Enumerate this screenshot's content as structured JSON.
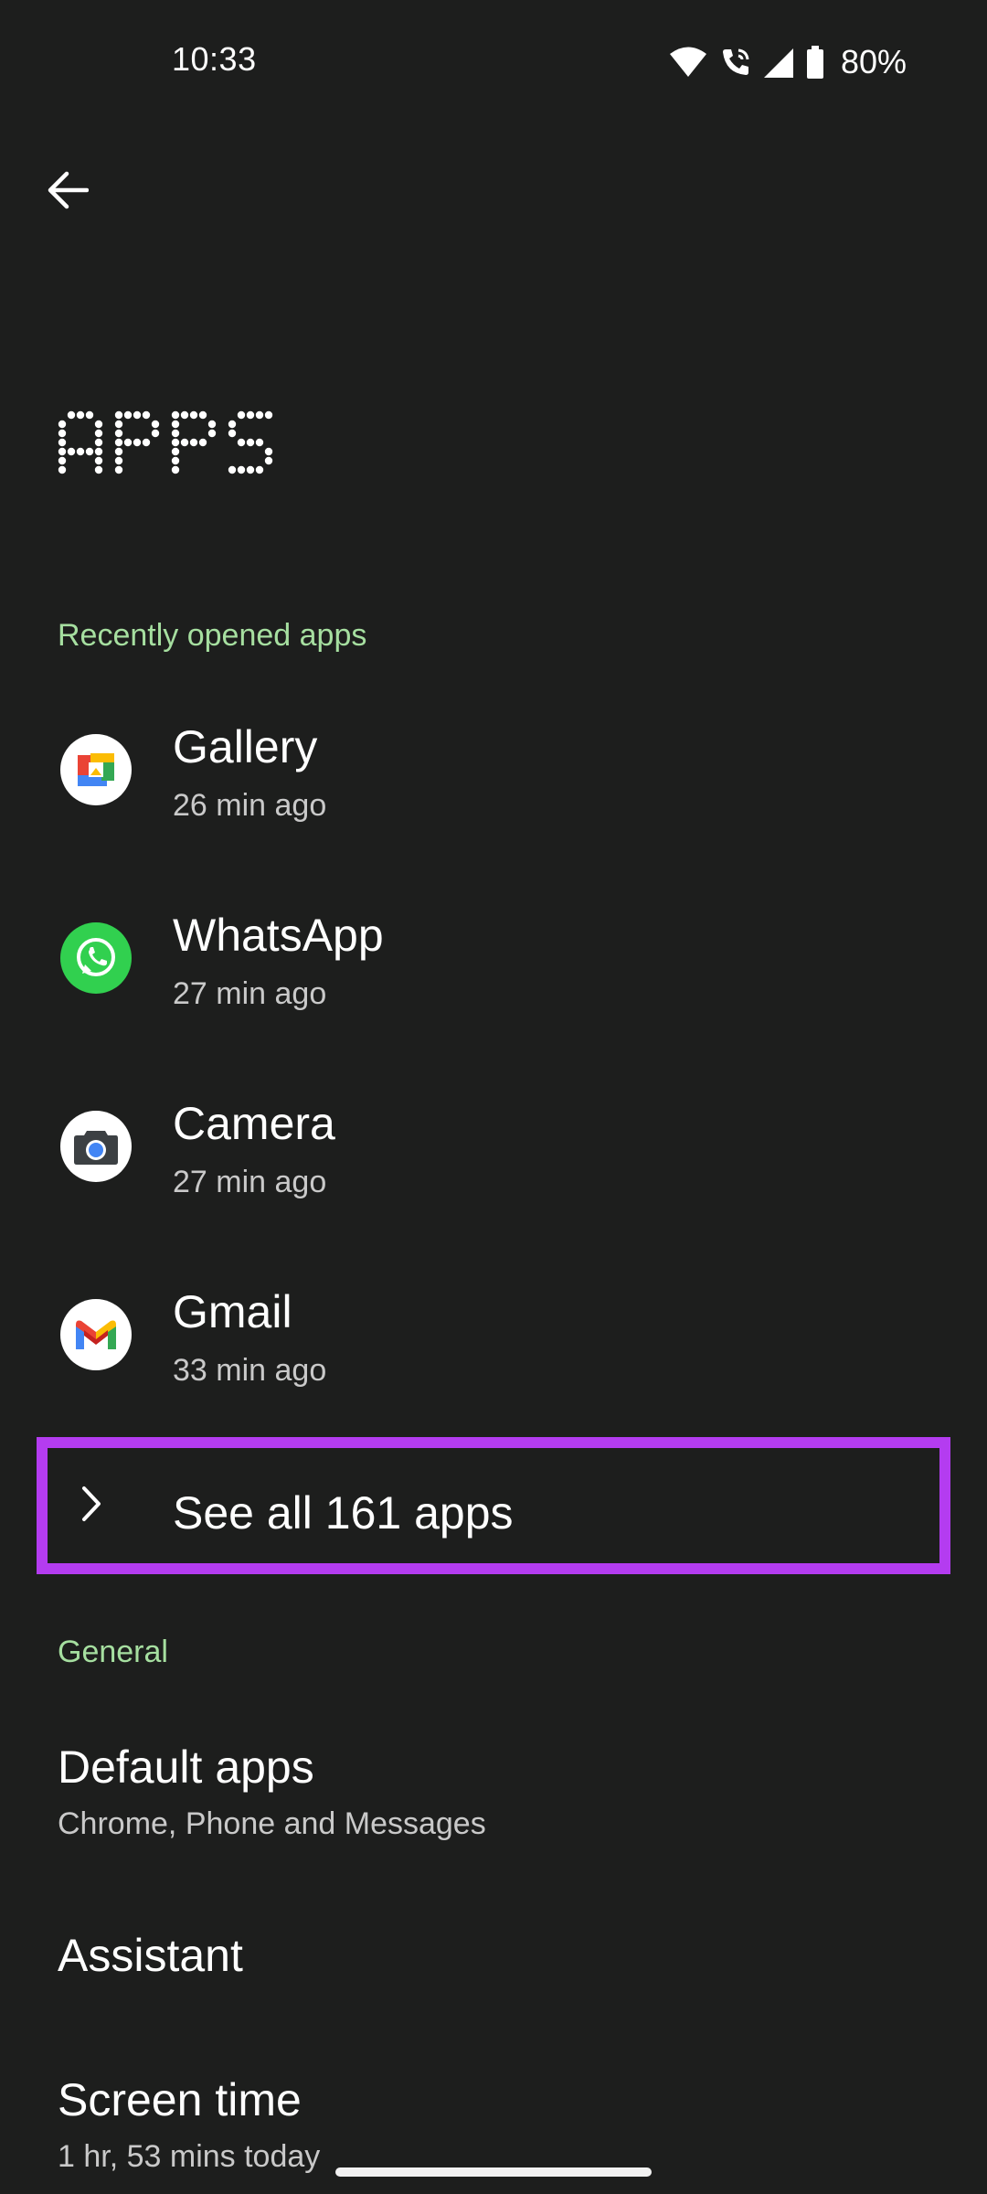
{
  "status_bar": {
    "time": "10:33",
    "battery": "80%"
  },
  "header": {
    "title": "APPS"
  },
  "recent": {
    "header": "Recently opened apps",
    "apps": [
      {
        "name": "Gallery",
        "time": "26 min ago",
        "icon": "gallery-icon"
      },
      {
        "name": "WhatsApp",
        "time": "27 min ago",
        "icon": "whatsapp-icon"
      },
      {
        "name": "Camera",
        "time": "27 min ago",
        "icon": "camera-icon"
      },
      {
        "name": "Gmail",
        "time": "33 min ago",
        "icon": "gmail-icon"
      }
    ],
    "see_all": "See all 161 apps"
  },
  "general": {
    "header": "General",
    "items": [
      {
        "title": "Default apps",
        "subtitle": "Chrome, Phone and Messages"
      },
      {
        "title": "Assistant"
      },
      {
        "title": "Screen time",
        "subtitle": "1 hr, 53 mins today"
      }
    ]
  },
  "colors": {
    "background": "#1d1e1d",
    "section_header": "#a6dfa0",
    "highlight_border": "#b43cf0",
    "whatsapp_green": "#31d04f"
  }
}
